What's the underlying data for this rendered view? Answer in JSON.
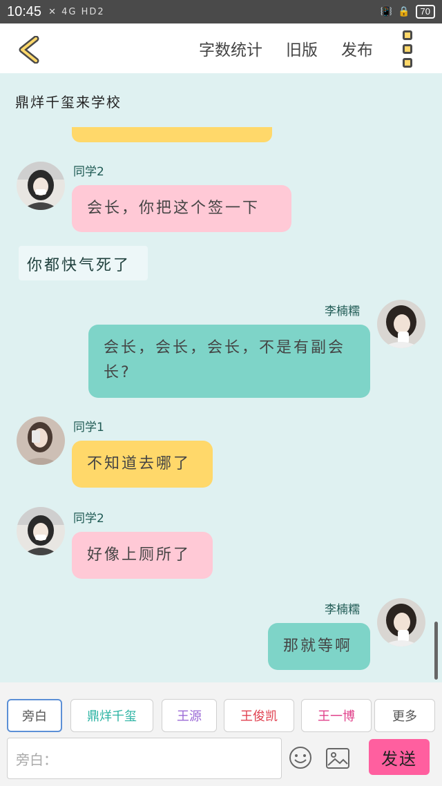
{
  "statusbar": {
    "time": "10:45",
    "network": "✕ 4G HD2",
    "battery": "70"
  },
  "topbar": {
    "word_count": "字数统计",
    "old_version": "旧版",
    "publish": "发布"
  },
  "chat": {
    "narration_header": "鼎烊千玺来学校",
    "messages": [
      {
        "name": "同学2",
        "text": "会长，你把这个签一下"
      },
      {
        "narration": "你都快气死了"
      },
      {
        "name": "李楠糯",
        "text": "会长，会长，会长，不是有副会长?"
      },
      {
        "name": "同学1",
        "text": "不知道去哪了"
      },
      {
        "name": "同学2",
        "text": "好像上厕所了"
      },
      {
        "name": "李楠糯",
        "text": "那就等啊"
      }
    ]
  },
  "chips": [
    "旁白",
    "鼎烊千玺",
    "王源",
    "王俊凯",
    "王一博",
    "更多"
  ],
  "chip_colors": [
    "#555555",
    "#2bb3a3",
    "#9b6ad6",
    "#e0404f",
    "#e0408a",
    "#555555"
  ],
  "input": {
    "placeholder": "旁白："
  },
  "send_label": "发送",
  "colors": {
    "pink": "#ffc9d6",
    "teal": "#7ed4c8",
    "yellow": "#ffd86a",
    "send": "#ff5f9f",
    "background": "#dff1f1"
  }
}
